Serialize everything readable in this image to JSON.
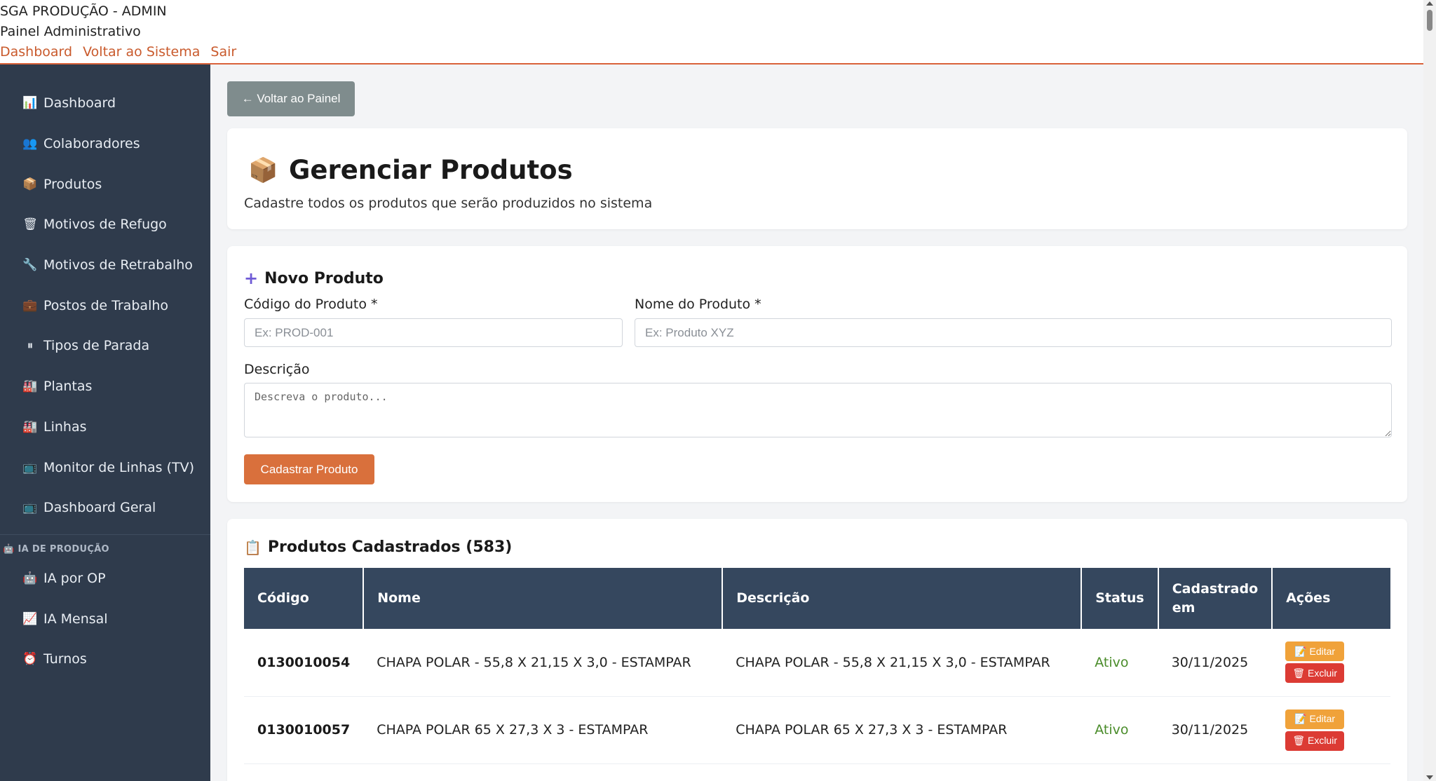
{
  "header": {
    "title": "SGA PRODUÇÃO - ADMIN",
    "subtitle": "Painel Administrativo",
    "links": [
      "Dashboard",
      "Voltar ao Sistema",
      "Sair"
    ]
  },
  "sidebar": {
    "items": [
      {
        "label": "Dashboard",
        "icon": "📊"
      },
      {
        "label": "Colaboradores",
        "icon": "👥"
      },
      {
        "label": "Produtos",
        "icon": "📦"
      },
      {
        "label": "Motivos de Refugo",
        "icon": "🗑"
      },
      {
        "label": "Motivos de Retrabalho",
        "icon": "🔧"
      },
      {
        "label": "Postos de Trabalho",
        "icon": "💼"
      },
      {
        "label": "Tipos de Parada",
        "icon": "⏸"
      },
      {
        "label": "Plantas",
        "icon": "🏭"
      },
      {
        "label": "Linhas",
        "icon": "🏭"
      },
      {
        "label": "Monitor de Linhas (TV)",
        "icon": "📺"
      },
      {
        "label": "Dashboard Geral",
        "icon": "📺"
      }
    ],
    "section_label": "IA DE PRODUÇÃO",
    "section_icon": "🤖",
    "ai_items": [
      {
        "label": "IA por OP",
        "icon": "🤖"
      },
      {
        "label": "IA Mensal",
        "icon": "📈"
      },
      {
        "label": "Turnos",
        "icon": "⏰"
      }
    ]
  },
  "main": {
    "back_button": "← Voltar ao Painel",
    "page_icon": "📦",
    "page_title": "Gerenciar Produtos",
    "page_subtitle": "Cadastre todos os produtos que serão produzidos no sistema",
    "form": {
      "title": "Novo Produto",
      "title_icon": "➕",
      "code_label": "Código do Produto *",
      "code_placeholder": "Ex: PROD-001",
      "name_label": "Nome do Produto *",
      "name_placeholder": "Ex: Produto XYZ",
      "desc_label": "Descrição",
      "desc_placeholder": "Descreva o produto...",
      "submit": "Cadastrar Produto"
    },
    "list": {
      "title": "Produtos Cadastrados (583)",
      "title_icon": "📋",
      "columns": [
        "Código",
        "Nome",
        "Descrição",
        "Status",
        "Cadastrado em",
        "Ações"
      ],
      "rows": [
        {
          "code": "0130010054",
          "name": "CHAPA POLAR - 55,8 X 21,15 X 3,0 - ESTAMPAR",
          "description": "CHAPA POLAR - 55,8 X 21,15 X 3,0 - ESTAMPAR",
          "status": "Ativo",
          "created": "30/11/2025"
        },
        {
          "code": "0130010057",
          "name": "CHAPA POLAR 65 X 27,3 X 3 - ESTAMPAR",
          "description": "CHAPA POLAR 65 X 27,3 X 3 - ESTAMPAR",
          "status": "Ativo",
          "created": "30/11/2025"
        }
      ],
      "edit_label": "📝 Editar",
      "delete_label": "🗑 Excluir"
    }
  },
  "colors": {
    "accent": "#d9623a",
    "sidebar": "#2f3b4c",
    "table_header": "#35475e",
    "status_active": "#4a8c2a",
    "edit": "#f0a23a",
    "delete": "#dc3b34"
  }
}
